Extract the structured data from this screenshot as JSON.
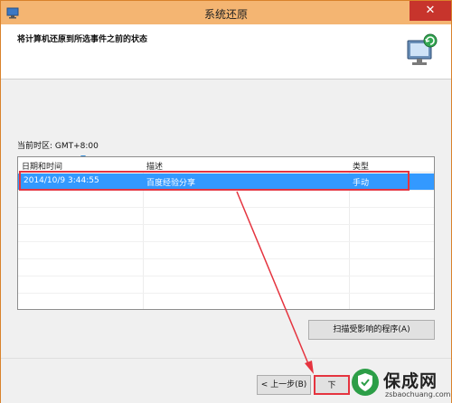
{
  "window": {
    "title": "系统还原",
    "close_glyph": "✕",
    "frame_color": "#d9822b"
  },
  "header": {
    "heading": "将计算机还原到所选事件之前的状态",
    "icon": "system-restore-icon"
  },
  "timezone_label": "当前时区: GMT+8:00",
  "table": {
    "columns": [
      "日期和时间",
      "描述",
      "类型"
    ],
    "rows": [
      {
        "date": "2014/10/9 3:44:55",
        "description": "百度经验分享",
        "type": "手动",
        "selected": true
      }
    ],
    "selection_color": "#3399ff"
  },
  "buttons": {
    "scan": "扫描受影响的程序(A)",
    "back": "< 上一步(B)",
    "next": "下"
  },
  "annotation": {
    "color": "#e5343f"
  },
  "watermark": {
    "name": "保成网",
    "domain": "zsbaochuang.com",
    "icon": "shield-icon"
  }
}
